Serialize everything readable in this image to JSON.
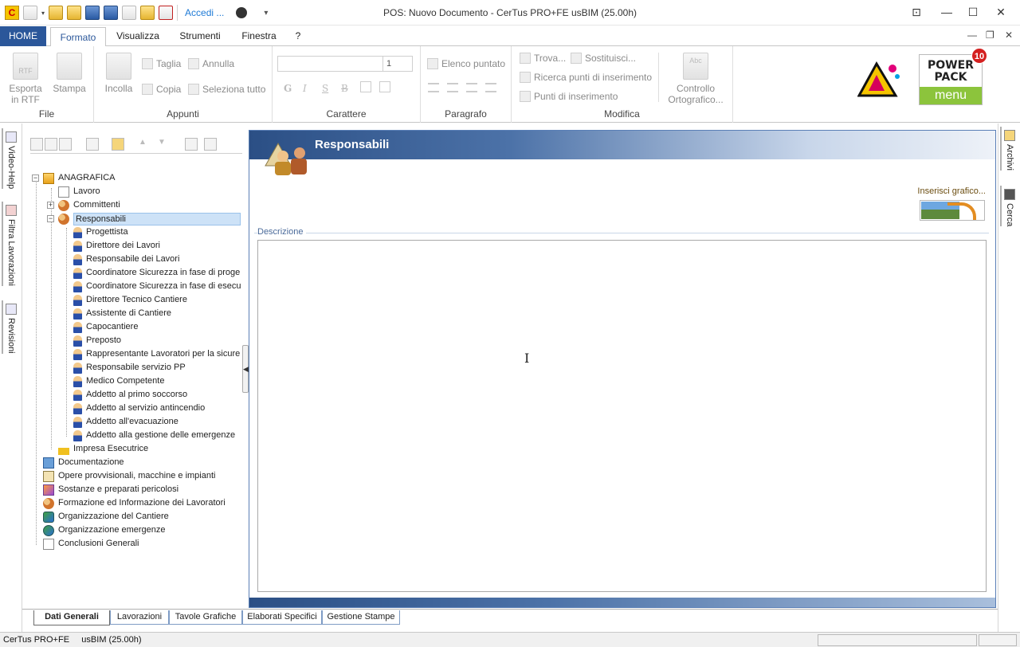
{
  "window": {
    "title": "POS: Nuovo Documento - CerTus PRO+FE   usBIM (25.00h)",
    "accedi_label": "Accedi ...",
    "controls": {
      "restore": "⊡",
      "minimize": "—",
      "maximize": "☐",
      "close": "✕"
    },
    "mdi_controls": {
      "minimize": "—",
      "restore": "❐",
      "close": "✕"
    }
  },
  "ribbon": {
    "tabs": [
      {
        "label": "HOME"
      },
      {
        "label": "Formato"
      },
      {
        "label": "Visualizza"
      },
      {
        "label": "Strumenti"
      },
      {
        "label": "Finestra"
      },
      {
        "label": "?"
      }
    ],
    "groups": {
      "file": {
        "label": "File",
        "esporta": "Esporta in RTF",
        "stampa": "Stampa"
      },
      "appunti": {
        "label": "Appunti",
        "incolla": "Incolla",
        "taglia": "Taglia",
        "copia": "Copia",
        "annulla": "Annulla",
        "seleziona": "Seleziona tutto"
      },
      "carattere": {
        "label": "Carattere",
        "size": "1",
        "styles": [
          "G",
          "I",
          "S",
          "B"
        ]
      },
      "paragrafo": {
        "label": "Paragrafo",
        "elenco": "Elenco puntato"
      },
      "modifica": {
        "label": "Modifica",
        "trova": "Trova...",
        "sostituisci": "Sostituisci...",
        "ricerca": "Ricerca punti di inserimento",
        "punti": "Punti di inserimento",
        "controllo": "Controllo Ortografico..."
      }
    },
    "powerpack": {
      "line1": "POWER",
      "line2": "PACK",
      "menu": "menu",
      "badge": "10"
    },
    "file_icon_label": "RTF",
    "abc_icon_label": "Abc"
  },
  "sidebars": {
    "left": [
      "Video-Help",
      "Filtra Lavorazioni",
      "Revisioni"
    ],
    "right": [
      "Archivi",
      "Cerca"
    ]
  },
  "tree": {
    "root": "ANAGRAFICA",
    "lavoro": "Lavoro",
    "committenti": "Committenti",
    "responsabili": "Responsabili",
    "responsabili_children": [
      "Progettista",
      "Direttore dei Lavori",
      "Responsabile dei Lavori",
      "Coordinatore Sicurezza in fase di proge",
      "Coordinatore Sicurezza in fase di esecu",
      "Direttore Tecnico Cantiere",
      "Assistente di Cantiere",
      "Capocantiere",
      "Preposto",
      "Rappresentante Lavoratori per la sicure",
      "Responsabile servizio PP",
      "Medico Competente",
      "Addetto al primo soccorso",
      "Addetto al servizio antincendio",
      "Addetto all'evacuazione",
      "Addetto alla gestione delle emergenze"
    ],
    "impresa": "Impresa Esecutrice",
    "top_level": [
      "Documentazione",
      "Opere provvisionali, macchine e impianti",
      "Sostanze e preparati pericolosi",
      "Formazione ed Informazione dei Lavoratori",
      "Organizzazione del Cantiere",
      "Organizzazione emergenze",
      "Conclusioni Generali"
    ]
  },
  "main": {
    "title": "Responsabili",
    "inserisci": "Inserisci grafico...",
    "descrizione_label": "Descrizione",
    "descrizione_value": ""
  },
  "bottom_tabs": [
    "Dati Generali",
    "Lavorazioni",
    "Tavole Grafiche",
    "Elaborati Specifici",
    "Gestione Stampe"
  ],
  "status": {
    "text": "CerTus PRO+FE     usBIM (25.00h)"
  },
  "colors": {
    "ribbon_home": "#2b579a",
    "header_dark": "#2b4f85",
    "selection": "#cde2f7",
    "powerpack_green": "#8cc43c"
  }
}
